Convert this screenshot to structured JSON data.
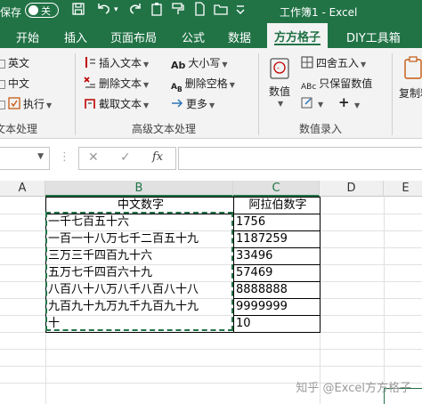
{
  "titlebar": {
    "autosave_label": "保存",
    "toggle_state": "关",
    "title": "工作簿1  -  Excel"
  },
  "tabs": [
    "开始",
    "插入",
    "页面布局",
    "公式",
    "数据",
    "方方格子",
    "DIY工具箱"
  ],
  "ribbon": {
    "left_items": [
      "英文",
      "中文",
      "执行"
    ],
    "left_group_label": "文本处理",
    "text_tools": {
      "insert_text": "插入文本",
      "delete_text": "删除文本",
      "extract_text": "截取文本",
      "case": "大小写",
      "delete_space": "删除空格",
      "more": "更多"
    },
    "text_group_label": "高级文本处理",
    "numeric": {
      "value": "数值",
      "round": "四舍五入",
      "keep_values": "只保留数值",
      "group_label": "数值录入"
    },
    "copy_label": "复制粘"
  },
  "formula_bar": {
    "name_box": "",
    "fx": "fx",
    "formula": ""
  },
  "columns": [
    "A",
    "B",
    "C",
    "D",
    "E"
  ],
  "table": {
    "header_chinese": "中文数字",
    "header_arabic": "阿拉伯数字",
    "rows": [
      {
        "chinese": "一千七百五十六",
        "arabic": "1756"
      },
      {
        "chinese": "一百一十八万七千二百五十九",
        "arabic": "1187259"
      },
      {
        "chinese": "三万三千四百九十六",
        "arabic": "33496"
      },
      {
        "chinese": "五万七千四百六十九",
        "arabic": "57469"
      },
      {
        "chinese": "八百八十八万八千八百八十八",
        "arabic": "8888888"
      },
      {
        "chinese": "九百九十九万九千九百九十九",
        "arabic": "9999999"
      },
      {
        "chinese": "十",
        "arabic": "10"
      }
    ]
  },
  "watermark": "知乎 @Excel方方格子"
}
